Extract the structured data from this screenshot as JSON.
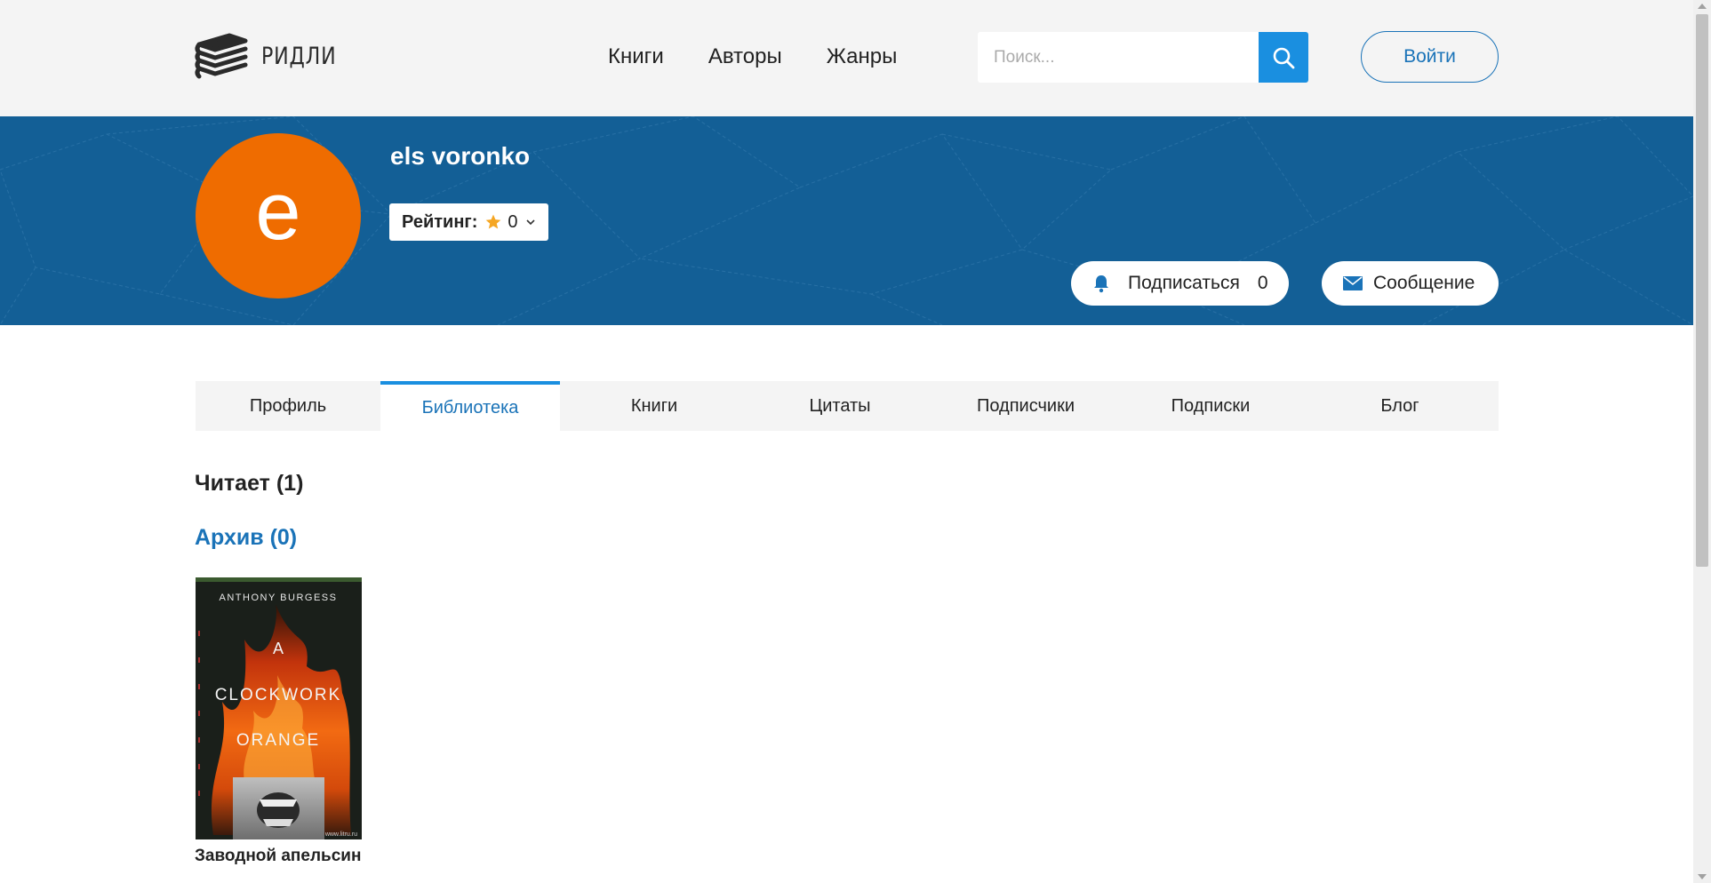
{
  "header": {
    "logo_text": "РИДЛИ",
    "nav": [
      {
        "label": "Книги"
      },
      {
        "label": "Авторы"
      },
      {
        "label": "Жанры"
      }
    ],
    "search_placeholder": "Поиск...",
    "login_label": "Войти"
  },
  "profile": {
    "avatar_letter": "e",
    "avatar_color": "#ef6c00",
    "username": "els voronko",
    "rating_label": "Рейтинг:",
    "rating_value": "0",
    "subscribe_label": "Подписаться",
    "subscribe_count": "0",
    "message_label": "Сообщение"
  },
  "tabs": [
    {
      "label": "Профиль",
      "active": false
    },
    {
      "label": "Библиотека",
      "active": true
    },
    {
      "label": "Книги",
      "active": false
    },
    {
      "label": "Цитаты",
      "active": false
    },
    {
      "label": "Подписчики",
      "active": false
    },
    {
      "label": "Подписки",
      "active": false
    },
    {
      "label": "Блог",
      "active": false
    }
  ],
  "library": {
    "reading_label": "Читает (1)",
    "archive_label": "Архив (0)",
    "books": [
      {
        "cover_author": "ANTHONY BURGESS",
        "cover_title_line1": "A",
        "cover_title_line2": "CLOCKWORK",
        "cover_title_line3": "ORANGE",
        "cover_watermark": "www.litru.ru",
        "title": "Заводной апельсин"
      }
    ]
  },
  "colors": {
    "accent": "#1a8fe0",
    "link": "#1a73b8",
    "banner": "#135f96",
    "header_bg": "#f4f4f4"
  }
}
